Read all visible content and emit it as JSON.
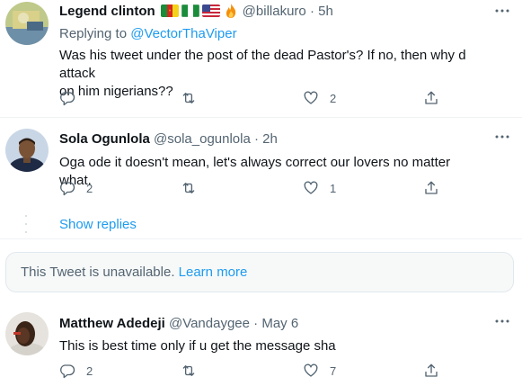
{
  "tweets": [
    {
      "name": "Legend clinton",
      "handle": "@billakuro",
      "separator": "·",
      "time": "5h",
      "replying_prefix": "Replying to ",
      "replying_to": "@VectorThaViper",
      "text_line1": "Was his tweet under the post of the dead Pastor's? If no, then why d attack",
      "text_line2": "on him nigerians??",
      "reply_count": "",
      "retweet_count": "",
      "like_count": "2",
      "flags": [
        "cameroon-flag",
        "nigeria-flag",
        "usa-flag",
        "fire-icon"
      ]
    },
    {
      "name": "Sola Ogunlola",
      "handle": "@sola_ogunlola",
      "separator": "·",
      "time": "2h",
      "text_line1": "Oga ode it doesn't mean, let's always correct our lovers no matter what.",
      "reply_count": "2",
      "retweet_count": "",
      "like_count": "1"
    },
    {
      "name": "Matthew Adedeji",
      "handle": "@Vandaygee",
      "separator": "·",
      "time": "May 6",
      "text_line1": "This is best time only if u get the message sha",
      "reply_count": "2",
      "retweet_count": "",
      "like_count": "7"
    }
  ],
  "show_replies": "Show replies",
  "unavailable": {
    "message": "This Tweet is unavailable.",
    "link": "Learn more"
  },
  "colors": {
    "accent": "#1d9bf0",
    "secondary_text": "#536471",
    "primary_text": "#0f1419",
    "border": "#eff3f4"
  }
}
